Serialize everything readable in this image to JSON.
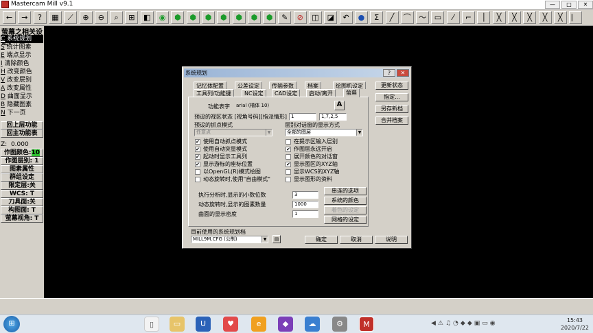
{
  "window": {
    "title": "Mastercam Mill v9.1",
    "min": "—",
    "max": "□",
    "close": "✕"
  },
  "toolbar": {
    "icons": [
      "←",
      "→",
      "?",
      "▦",
      "⟋",
      "⊕",
      "⊖",
      "⌕",
      "⊞",
      "◧",
      "◉",
      "⬢",
      "⬢",
      "⬢",
      "⬢",
      "⬢",
      "⬢",
      "⬢",
      "✎",
      "⊘",
      "◫",
      "◪",
      "↶",
      "●",
      "Σ",
      "╱",
      "⌒",
      "〜",
      "▭",
      "⁄",
      "⌐",
      "│",
      "╳",
      "╳",
      "╳",
      "╳",
      "╳",
      "⎸"
    ]
  },
  "sidebar": {
    "header": "萤幕之相关设定:",
    "items": [
      {
        "key": "C",
        "label": "系统规划"
      },
      {
        "key": "S",
        "label": "统计图素"
      },
      {
        "key": "E",
        "label": "端点显示"
      },
      {
        "key": "I",
        "label": "清除颜色"
      },
      {
        "key": "H",
        "label": "改变颜色"
      },
      {
        "key": "V",
        "label": "改变层别"
      },
      {
        "key": "A",
        "label": "改变属性"
      },
      {
        "key": "D",
        "label": "曲面显示"
      },
      {
        "key": "B",
        "label": "隐藏图素"
      },
      {
        "key": "N",
        "label": "下一页"
      }
    ],
    "back": "回上层功能",
    "main": "回主功能表",
    "z_label": "Z:",
    "z_value": "0.000",
    "color_label": "作图颜色:",
    "color_value": "10",
    "layer_label": "作图层别:",
    "layer_value": "1",
    "attr": "图素属性",
    "group": "群组设定",
    "limit": "限定层:关",
    "wcs": "WCS: T",
    "tool": "刀具面:关",
    "cplane": "构图面: T",
    "view": "萤幕视角: T"
  },
  "dialog": {
    "title": "系统规划",
    "help": "?",
    "close": "✕",
    "tabs_row1": [
      "记忆体配置",
      "公差设定",
      "传输参数",
      "档案",
      "绘图机设定"
    ],
    "tabs_row2": [
      "工具列/功能键",
      "NC设定",
      "CAD设定",
      "启动/离开",
      "萤幕"
    ],
    "font_label": "功能表字",
    "font_value": "arial (楷体 10)",
    "font_btn": "A",
    "viewport_label": "预设的视区状态 [视角号码][指派情形]",
    "viewport_val1": "1",
    "viewport_val2": "1,7,2,5",
    "snap_group": "预设的抓点模式",
    "snap_value": "任意点",
    "prompt_group": "层别对话窗的显示方式",
    "prompt_value": "全部的图层",
    "left_checks": [
      {
        "label": "使用自动抓点模式",
        "checked": true
      },
      {
        "label": "使用自动突显模式",
        "checked": true
      },
      {
        "label": "起动时显示工具列",
        "checked": true
      },
      {
        "label": "显示游标的座标位置",
        "checked": true
      },
      {
        "label": "以OpenGL(R)模式绘图",
        "checked": false
      },
      {
        "label": "动态旋转时,使用\"自由模式\"",
        "checked": false
      }
    ],
    "right_checks": [
      {
        "label": "在提示区输入层别",
        "checked": false
      },
      {
        "label": "作图层永远开启",
        "checked": true
      },
      {
        "label": "展开颜色的对话窗",
        "checked": false
      },
      {
        "label": "显示图区的XYZ轴",
        "checked": true
      },
      {
        "label": "显示WCS的XYZ轴",
        "checked": false
      },
      {
        "label": "显示图形的资料",
        "checked": false
      }
    ],
    "decimals_label": "执行分析时,显示的小数位数",
    "decimals_value": "3",
    "rotate_label": "动态旋转时,显示的图素数量",
    "rotate_value": "1000",
    "density_label": "曲面的显示密度",
    "density_value": "1",
    "btn_serial": "串连的选项",
    "btn_sys_color": "系统的颜色",
    "btn_shading": "着色的设定",
    "btn_grid": "网格的设定",
    "side_btns": [
      "更新状态",
      "指定...",
      "另存新档",
      "合并档案"
    ],
    "current_label": "目前使用的系统规划档",
    "current_value": "MILL9M.CFG (公制)",
    "ok": "确定",
    "cancel": "取消",
    "help_btn": "说明"
  },
  "taskbar": {
    "time": "15:43",
    "date": "2020/7/22"
  }
}
